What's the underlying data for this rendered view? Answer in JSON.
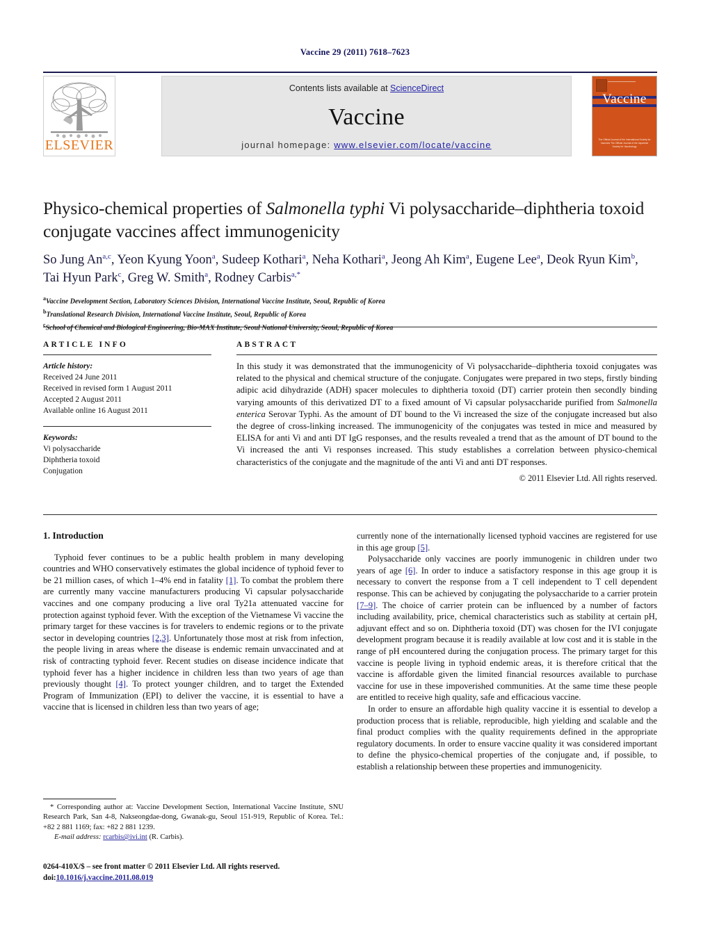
{
  "running_head": "Vaccine 29 (2011) 7618–7623",
  "masthead": {
    "contents_prefix": "Contents lists available at ",
    "sciencedirect": "ScienceDirect",
    "journal_title": "Vaccine",
    "homepage_prefix": "journal homepage: ",
    "homepage_url": "www.elsevier.com/locate/vaccine",
    "elsevier_wordmark": "ELSEVIER",
    "cover_word": "Vaccine",
    "cover_footnote": "The Official Journal of the International Society for Vaccines\nThe Official Journal of the Japanese Society for Vaccinology",
    "accent_orange": "#E8761A",
    "cover_orange": "#D1531B",
    "link_blue": "#2222aa"
  },
  "article": {
    "title_part1": "Physico-chemical properties of ",
    "title_italic": "Salmonella typhi",
    "title_part2": " Vi polysaccharide–diphtheria toxoid conjugate vaccines affect immunogenicity",
    "authors_line1": "So Jung An",
    "authors": "So Jung An a,c, Yeon Kyung Yoon a, Sudeep Kothari a, Neha Kothari a, Jeong Ah Kim a, Eugene Lee a, Deok Ryun Kim b, Tai Hyun Park c, Greg W. Smith a, Rodney Carbis a,*",
    "affiliation_a": "Vaccine Development Section, Laboratory Sciences Division, International Vaccine Institute, Seoul, Republic of Korea",
    "affiliation_b": "Translational Research Division, International Vaccine Institute, Seoul, Republic of Korea",
    "affiliation_c": "School of Chemical and Biological Engineering, Bio-MAX Institute, Seoul National University, Seoul, Republic of Korea"
  },
  "article_info": {
    "heading": "ARTICLE INFO",
    "history_label": "Article history:",
    "history": [
      "Received 24 June 2011",
      "Received in revised form 1 August 2011",
      "Accepted 2 August 2011",
      "Available online 16 August 2011"
    ],
    "keywords_label": "Keywords:",
    "keywords": [
      "Vi polysaccharide",
      "Diphtheria toxoid",
      "Conjugation"
    ]
  },
  "abstract": {
    "heading": "ABSTRACT",
    "p1": "In this study it was demonstrated that the immunogenicity of Vi polysaccharide–diphtheria toxoid conjugates was related to the physical and chemical structure of the conjugate. Conjugates were prepared in two steps, firstly binding adipic acid dihydrazide (ADH) spacer molecules to diphtheria toxoid (DT) carrier protein then secondly binding varying amounts of this derivatized DT to a fixed amount of Vi capsular polysaccharide purified from ",
    "p1_italic": "Salmonella enterica",
    "p1_rest": " Serovar Typhi. As the amount of DT bound to the Vi increased the size of the conjugate increased but also the degree of cross-linking increased. The immunogenicity of the conjugates was tested in mice and measured by ELISA for anti Vi and anti DT IgG responses, and the results revealed a trend that as the amount of DT bound to the Vi increased the anti Vi responses increased. This study establishes a correlation between physico-chemical characteristics of the conjugate and the magnitude of the anti Vi and anti DT responses.",
    "copyright": "© 2011 Elsevier Ltd. All rights reserved."
  },
  "body": {
    "section_title": "1. Introduction",
    "left_p1_a": "Typhoid fever continues to be a public health problem in many developing countries and WHO conservatively estimates the global incidence of typhoid fever to be 21 million cases, of which 1–4% end in fatality ",
    "left_ref1": "[1]",
    "left_p1_b": ". To combat the problem there are currently many vaccine manufacturers producing Vi capsular polysaccharide vaccines and one company producing a live oral Ty21a attenuated vaccine for protection against typhoid fever. With the exception of the Vietnamese Vi vaccine the primary target for these vaccines is for travelers to endemic regions or to the private sector in developing countries ",
    "left_ref2": "[2,3]",
    "left_p1_c": ". Unfortunately those most at risk from infection, the people living in areas where the disease is endemic remain unvaccinated and at risk of contracting typhoid fever. Recent studies on disease incidence indicate that typhoid fever has a higher incidence in children less than two years of age than previously thought ",
    "left_ref3": "[4]",
    "left_p1_d": ". To protect younger children, and to target the Extended Program of Immunization (EPI) to deliver the vaccine, it is essential to have a vaccine that is licensed in children less than two years of age;",
    "right_p1_a": "currently none of the internationally licensed typhoid vaccines are registered for use in this age group ",
    "right_ref5": "[5]",
    "right_p1_b": ".",
    "right_p2_a": "Polysaccharide only vaccines are poorly immunogenic in children under two years of age ",
    "right_ref6": "[6]",
    "right_p2_b": ". In order to induce a satisfactory response in this age group it is necessary to convert the response from a T cell independent to T cell dependent response. This can be achieved by conjugating the polysaccharide to a carrier protein ",
    "right_ref79": "[7–9]",
    "right_p2_c": ". The choice of carrier protein can be influenced by a number of factors including availability, price, chemical characteristics such as stability at certain pH, adjuvant effect and so on. Diphtheria toxoid (DT) was chosen for the IVI conjugate development program because it is readily available at low cost and it is stable in the range of pH encountered during the conjugation process. The primary target for this vaccine is people living in typhoid endemic areas, it is therefore critical that the vaccine is affordable given the limited financial resources available to purchase vaccine for use in these impoverished communities. At the same time these people are entitled to receive high quality, safe and efficacious vaccine.",
    "right_p3": "In order to ensure an affordable high quality vaccine it is essential to develop a production process that is reliable, reproducible, high yielding and scalable and the final product complies with the quality requirements defined in the appropriate regulatory documents. In order to ensure vaccine quality it was considered important to define the physico-chemical properties of the conjugate and, if possible, to establish a relationship between these properties and immunogenicity."
  },
  "footnotes": {
    "corresponding": "* Corresponding author at: Vaccine Development Section, International Vaccine Institute, SNU Research Park, San 4-8, Nakseongdae-dong, Gwanak-gu, Seoul 151-919, Republic of Korea. Tel.: +82 2 881 1169; fax: +82 2 881 1239.",
    "email_label": "E-mail address:",
    "email": "rcarbis@ivi.int",
    "email_suffix": " (R. Carbis).",
    "issn_line": "0264-410X/$ – see front matter © 2011 Elsevier Ltd. All rights reserved.",
    "doi_label": "doi:",
    "doi": "10.1016/j.vaccine.2011.08.019"
  }
}
